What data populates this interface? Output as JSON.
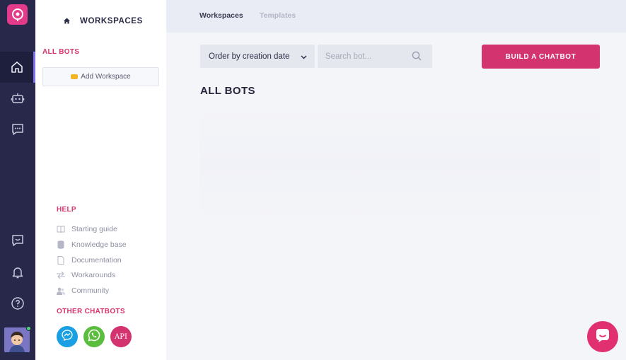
{
  "sidebar": {
    "title": "WORKSPACES",
    "all_bots": "ALL BOTS",
    "add_workspace": "Add Workspace",
    "help_title": "HELP",
    "help_items": [
      "Starting guide",
      "Knowledge base",
      "Documentation",
      "Workarounds",
      "Community"
    ],
    "other_title": "OTHER CHATBOTS",
    "api_label": "API"
  },
  "tabs": [
    "Workspaces",
    "Templates"
  ],
  "main": {
    "order_label": "Order by creation date",
    "search_placeholder": "Search bot...",
    "build_button": "BUILD A CHATBOT",
    "title": "ALL BOTS"
  },
  "colors": {
    "accent": "#d3336f",
    "rail": "#27284a",
    "messenger": "#1aa0e2",
    "whatsapp": "#5bbd3e",
    "api": "#d3336f"
  },
  "icons": [
    "logo-icon",
    "home-icon",
    "bot-icon",
    "chat-icon",
    "feedback-icon",
    "bell-icon",
    "help-icon",
    "messenger-icon",
    "whatsapp-icon",
    "search-icon",
    "chevron-down-icon"
  ]
}
